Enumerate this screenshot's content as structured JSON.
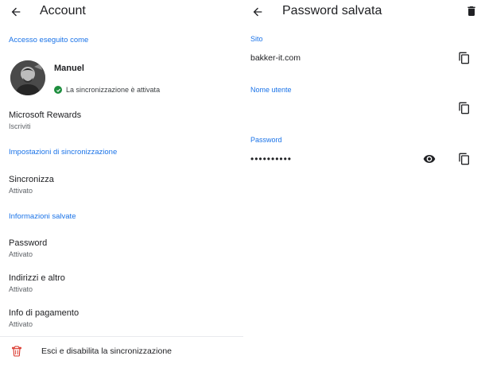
{
  "account": {
    "title": "Account",
    "signed_in_label": "Accesso eseguito come",
    "user_name": "Manuel",
    "sync_status": "La sincronizzazione è attivata",
    "rewards": {
      "title": "Microsoft Rewards",
      "subtitle": "Iscriviti"
    },
    "sync_settings_label": "Impostazioni di sincronizzazione",
    "sync": {
      "title": "Sincronizza",
      "subtitle": "Attivato"
    },
    "saved_info_label": "Informazioni salvate",
    "saved_items": [
      {
        "title": "Password",
        "subtitle": "Attivato"
      },
      {
        "title": "Indirizzi e altro",
        "subtitle": "Attivato"
      },
      {
        "title": "Info di pagamento",
        "subtitle": "Attivato"
      }
    ],
    "sign_out_label": "Esci e disabilita la sincronizzazione"
  },
  "saved_password": {
    "title": "Password salvata",
    "site_label": "Sito",
    "site_value": "bakker-it.com",
    "username_label": "Nome utente",
    "username_value": "",
    "password_label": "Password",
    "password_masked": "••••••••••"
  },
  "colors": {
    "accent": "#1a73e8",
    "text": "#202124",
    "secondary_text": "#5f6368",
    "sync_ok": "#1e8e3e",
    "danger": "#d93025"
  },
  "icons": {
    "back": "arrow-back-icon",
    "delete": "trash-icon",
    "copy": "copy-icon",
    "show_password": "eye-icon",
    "sync_ok": "check-circle-icon",
    "sign_out": "trash-outline-icon"
  }
}
